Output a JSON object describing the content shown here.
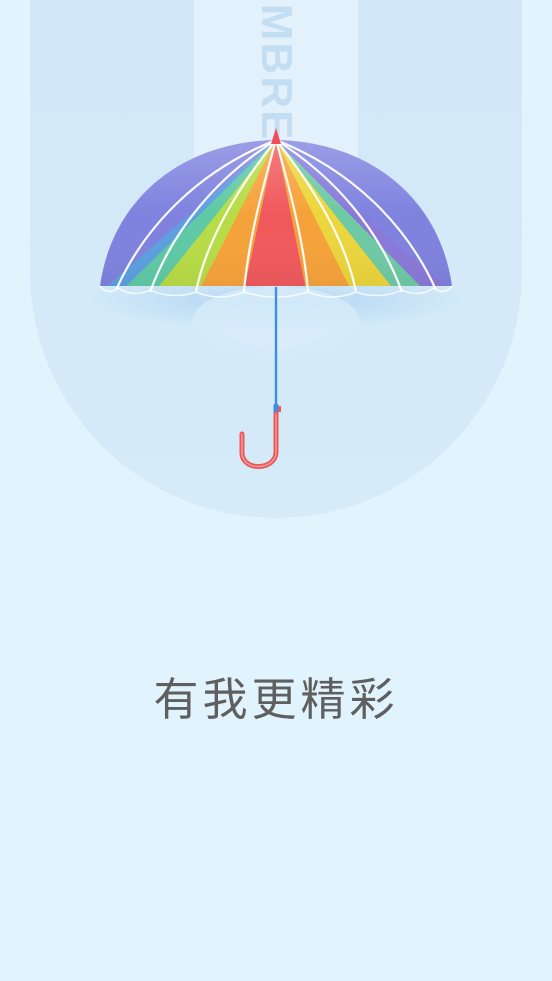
{
  "splash": {
    "watermark_text": "UMBRELLA",
    "slogan": "有我更精彩"
  },
  "colors": {
    "background": "#e1f4fd",
    "u_shape": "#d0e8f8",
    "slogan_text": "#5f5f5f",
    "handle": "#e85a5a",
    "shaft": "#3d8ee0"
  },
  "icons": {
    "umbrella": "rainbow-umbrella-icon"
  }
}
